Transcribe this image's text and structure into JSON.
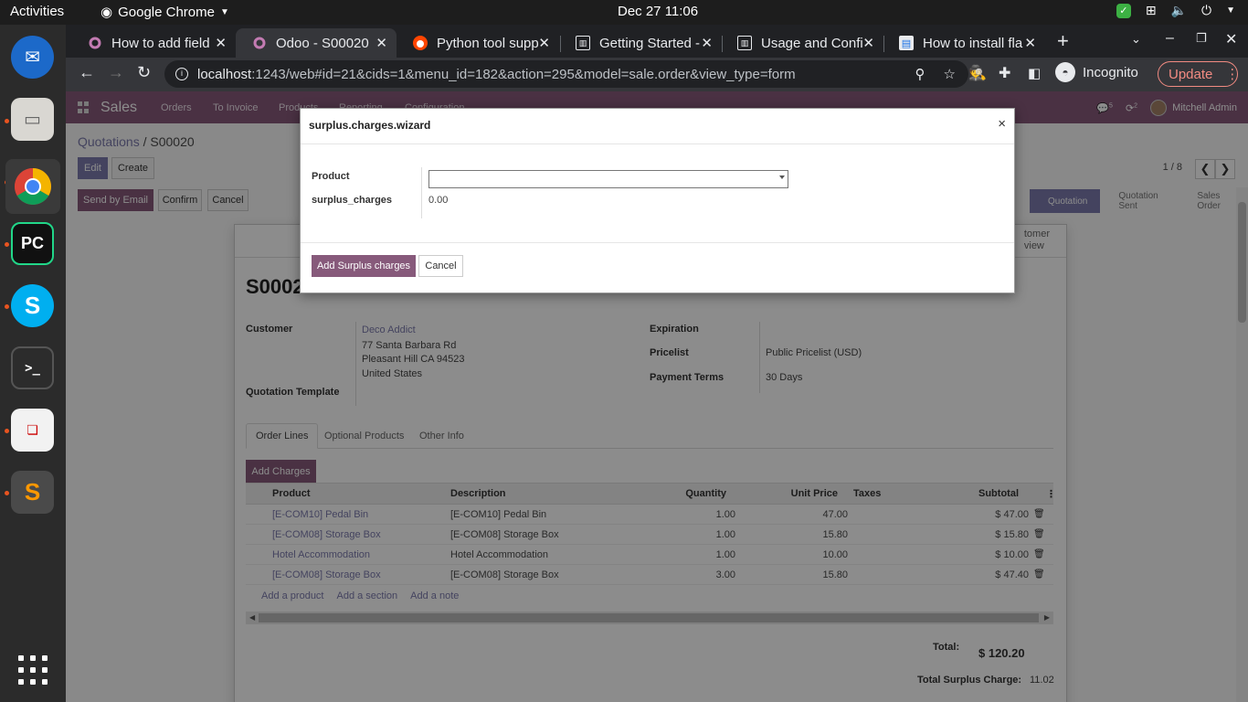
{
  "system": {
    "activities": "Activities",
    "app_name": "Google Chrome",
    "clock": "Dec 27  11:06"
  },
  "browser": {
    "tabs": [
      {
        "title": "How to add field",
        "icon": "odoo-icon"
      },
      {
        "title": "Odoo - S00020",
        "icon": "odoo-icon"
      },
      {
        "title": "Python tool supp",
        "icon": "reddit-icon"
      },
      {
        "title": "Getting Started -",
        "icon": "docs-icon"
      },
      {
        "title": "Usage and Confi",
        "icon": "docs-icon"
      },
      {
        "title": "How to install fla",
        "icon": "page-icon"
      }
    ],
    "url_host": "localhost",
    "url_rest": ":1243/web#id=21&cids=1&menu_id=182&action=295&model=sale.order&view_type=form",
    "incognito_label": "Incognito",
    "update_label": "Update"
  },
  "odoo_nav": {
    "app_title": "Sales",
    "menu": [
      "Orders",
      "To Invoice",
      "Products",
      "Reporting",
      "Configuration"
    ],
    "messages_count": "5",
    "activities_count": "2",
    "user": "Mitchell Admin"
  },
  "control_panel": {
    "breadcrumb_parent": "Quotations",
    "breadcrumb_sep": "/",
    "breadcrumb_current": "S00020",
    "edit_label": "Edit",
    "create_label": "Create",
    "pager": "1 / 8",
    "send_email_label": "Send by Email",
    "confirm_label": "Confirm",
    "cancel_label": "Cancel",
    "stages": [
      "Quotation",
      "Quotation Sent",
      "Sales Order"
    ],
    "active_stage": "Quotation"
  },
  "form": {
    "name": "S0002",
    "customer_preview_line1": "tomer",
    "customer_preview_line2": "view",
    "customer_label": "Customer",
    "customer_name": "Deco Addict",
    "address": [
      "77 Santa Barbara Rd",
      "Pleasant Hill CA 94523",
      "United States"
    ],
    "quotation_template_label": "Quotation Template",
    "expiration_label": "Expiration",
    "pricelist_label": "Pricelist",
    "pricelist_value": "Public Pricelist (USD)",
    "payment_terms_label": "Payment Terms",
    "payment_terms_value": "30 Days",
    "tabs": [
      "Order Lines",
      "Optional Products",
      "Other Info"
    ],
    "add_charges_label": "Add Charges",
    "columns": [
      "Product",
      "Description",
      "Quantity",
      "Unit Price",
      "Taxes",
      "Subtotal"
    ],
    "lines": [
      {
        "product": "[E-COM10] Pedal Bin",
        "description": "[E-COM10] Pedal Bin",
        "qty": "1.00",
        "price": "47.00",
        "taxes": "",
        "subtotal": "$ 47.00"
      },
      {
        "product": "[E-COM08] Storage Box",
        "description": "[E-COM08] Storage Box",
        "qty": "1.00",
        "price": "15.80",
        "taxes": "",
        "subtotal": "$ 15.80"
      },
      {
        "product": "Hotel Accommodation",
        "description": "Hotel Accommodation",
        "qty": "1.00",
        "price": "10.00",
        "taxes": "",
        "subtotal": "$ 10.00"
      },
      {
        "product": "[E-COM08] Storage Box",
        "description": "[E-COM08] Storage Box",
        "qty": "3.00",
        "price": "15.80",
        "taxes": "",
        "subtotal": "$ 47.40"
      }
    ],
    "add_product": "Add a product",
    "add_section": "Add a section",
    "add_note": "Add a note",
    "total_label": "Total:",
    "total_value": "$ 120.20",
    "surplus_label": "Total Surplus Charge:",
    "surplus_value": "11.02"
  },
  "wizard": {
    "title": "surplus.charges.wizard",
    "close": "×",
    "product_label": "Product",
    "product_value": "",
    "surplus_label": "surplus_charges",
    "surplus_value": "0.00",
    "confirm_label": "Add Surplus charges",
    "cancel_label": "Cancel"
  },
  "colors": {
    "odoo_brand": "#875a7b",
    "primary": "#7c7bad",
    "chrome_dark": "#202124",
    "update_accent": "#f28b82"
  }
}
